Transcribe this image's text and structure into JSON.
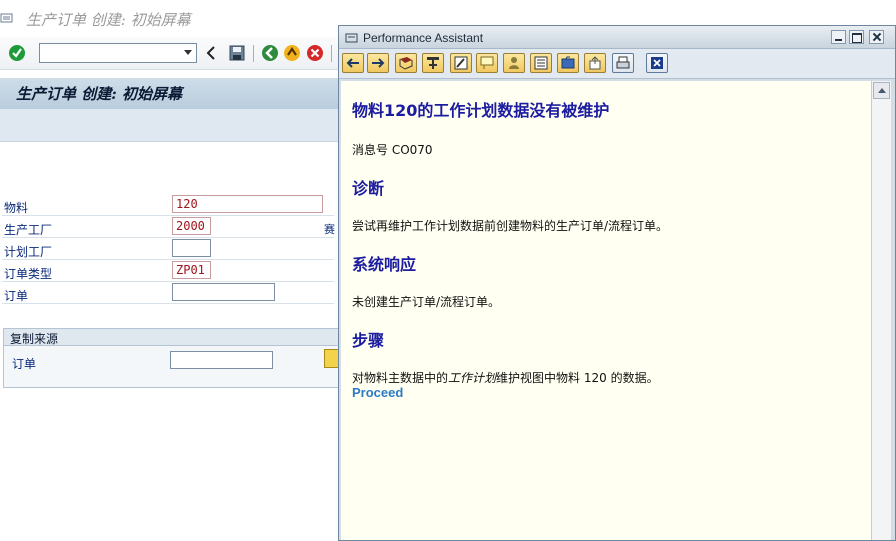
{
  "main": {
    "title": "生产订单 创建: 初始屏幕",
    "screen_title": "生产订单 创建: 初始屏幕",
    "fields": [
      {
        "label": "物料",
        "value": "120"
      },
      {
        "label": "生产工厂",
        "value": "2000"
      },
      {
        "label": "计划工厂",
        "value": ""
      },
      {
        "label": "订单类型",
        "value": "ZP01"
      },
      {
        "label": "订单",
        "value": ""
      }
    ],
    "side_text": "赛",
    "copy_group": {
      "title": "复制来源",
      "label": "订单",
      "value": ""
    }
  },
  "assistant": {
    "window_title": "Performance Assistant",
    "heading": "物料120的工作计划数据没有被维护",
    "message_no": "消息号  CO070",
    "diagnosis_title": "诊断",
    "diagnosis_text": "尝试再维护工作计划数据前创建物料的生产订单/流程订单。",
    "response_title": "系统响应",
    "response_text": "未创建生产订单/流程订单。",
    "steps_title": "步骤",
    "steps_text_1": "对物料主数据中的",
    "steps_text_italic": "工作计划",
    "steps_text_2": "维护视图中物料  120 的数据。",
    "link": "Proceed"
  },
  "icons": {
    "toolbar": [
      "check-icon",
      "back-arrow-icon",
      "save-icon",
      "green-back-icon",
      "exit-icon",
      "cancel-icon"
    ],
    "assistant_toolbar": [
      "back-icon",
      "forward-icon",
      "book-icon",
      "tree-icon",
      "edit-icon",
      "note-icon",
      "user-icon",
      "list-icon",
      "folder-icon",
      "export-icon",
      "print-icon",
      "close-icon"
    ]
  }
}
